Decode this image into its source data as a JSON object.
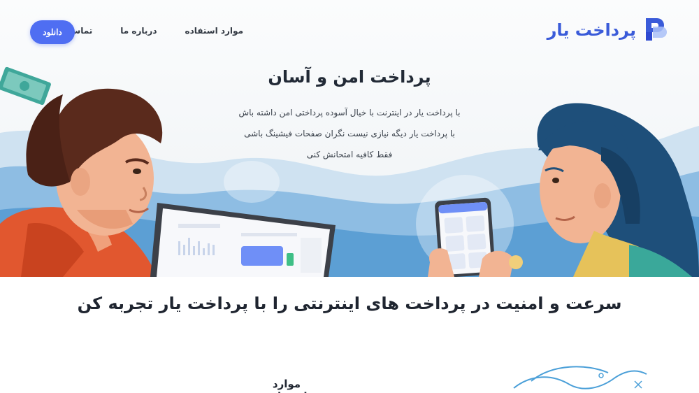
{
  "header": {
    "brand": "پرداخت یار",
    "nav": [
      {
        "label": "موارد استفاده"
      },
      {
        "label": "درباره ما"
      },
      {
        "label": "تماس با ما"
      }
    ],
    "download_label": "دانلود"
  },
  "hero": {
    "title": "پرداخت امن و آسان",
    "lines": [
      "با پرداخت یار در اینترنت با خیال آسوده پرداختی امن داشته باش",
      "با پرداخت یار دیگه نیازی نیست نگران صفحات فیشینگ باشی",
      "فقط کافیه امتحانش کنی"
    ]
  },
  "tagline": "سرعت و امنیت در پرداخت های اینترنتی را با پرداخت یار تجربه کن",
  "use_cases": {
    "title": "موارد استفاده"
  },
  "colors": {
    "accent": "#4f6ef2",
    "brand_text": "#3a5bd9",
    "sky": "#5c9fd4",
    "hair_man": "#5a2a1c",
    "shirt_man": "#e1572f",
    "hair_woman": "#1e4f7a"
  }
}
